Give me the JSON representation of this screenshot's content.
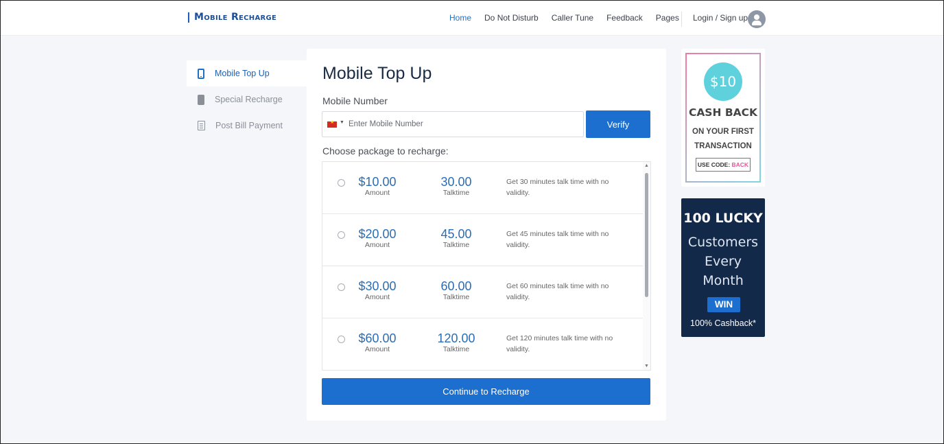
{
  "header": {
    "logo": "Mobile Recharge",
    "nav": [
      "Home",
      "Do Not Disturb",
      "Caller Tune",
      "Feedback",
      "Pages"
    ],
    "active_nav": "Home",
    "login": "Login / Sign up",
    "avatar_icon": "user-avatar-icon"
  },
  "sidebar": {
    "items": [
      {
        "label": "Mobile Top Up",
        "icon": "phone-icon",
        "active": true
      },
      {
        "label": "Special Recharge",
        "icon": "card-icon",
        "active": false
      },
      {
        "label": "Post Bill Payment",
        "icon": "document-icon",
        "active": false
      }
    ]
  },
  "main": {
    "title": "Mobile Top Up",
    "mobile_label": "Mobile Number",
    "mobile_placeholder": "Enter Mobile Number",
    "mobile_value": "",
    "verify_label": "Verify",
    "package_label": "Choose package to recharge:",
    "amount_caption": "Amount",
    "talktime_caption": "Talktime",
    "packages": [
      {
        "amount": "$10.00",
        "talktime": "30.00",
        "desc": "Get 30 minutes talk time with no validity."
      },
      {
        "amount": "$20.00",
        "talktime": "45.00",
        "desc": "Get 45 minutes talk time with no validity."
      },
      {
        "amount": "$30.00",
        "talktime": "60.00",
        "desc": "Get 60 minutes talk time with no validity."
      },
      {
        "amount": "$60.00",
        "talktime": "120.00",
        "desc": "Get 120 minutes talk time with no validity."
      }
    ],
    "continue_label": "Continue to Recharge"
  },
  "ads": {
    "cashback": {
      "coin": "$10",
      "headline": "CASH BACK",
      "line1": "ON YOUR FIRST",
      "line2": "TRANSACTION",
      "code_prefix": "USE CODE: ",
      "code": "BACK"
    },
    "lucky": {
      "headline": "100 LUCKY",
      "line1": "Customers",
      "line2": "Every",
      "line3": "Month",
      "badge": "WIN",
      "footer": "100% Cashback*"
    }
  },
  "colors": {
    "primary": "#1c6fcf",
    "accent_text": "#2a6db5",
    "ad_dark": "#13294a",
    "coin": "#5ed1dd",
    "code_pink": "#e8559a"
  }
}
